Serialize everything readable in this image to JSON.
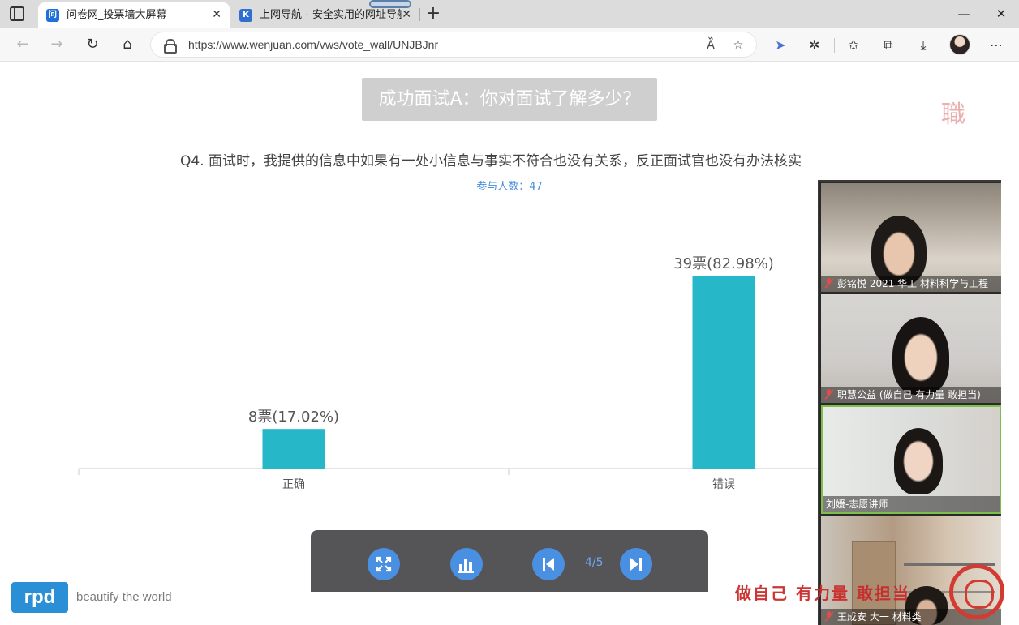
{
  "browser": {
    "tabs": [
      {
        "title": "问卷网_投票墙大屏幕",
        "active": true,
        "favicon": "wenjuan-icon"
      },
      {
        "title": "上网导航 - 安全实用的网址导航",
        "active": false,
        "favicon": "k-nav-icon"
      }
    ],
    "new_tab_label": "+",
    "url": "https://www.wenjuan.com/vws/vote_wall/UNJBJnr",
    "window_controls": {
      "minimize": "—",
      "maximize": "▢",
      "close": "✕"
    }
  },
  "page": {
    "title": "成功面试A：你对面试了解多少？",
    "question": "Q4. 面试时，我提供的信息中如果有一处小信息与事实不符合也没有关系，反正面试官也没有办法核实",
    "participants": "参与人数：47",
    "accent_color": "#4a90d9"
  },
  "chart_data": {
    "type": "bar",
    "categories": [
      "正确",
      "错误"
    ],
    "values": [
      8,
      39
    ],
    "data_labels": [
      "8票(17.02%)",
      "39票(82.98%)"
    ],
    "percentages": [
      17.02,
      82.98
    ],
    "ylim": [
      0,
      39
    ],
    "bar_color": "#26b8c8",
    "grid": false
  },
  "video_panel": {
    "participants": [
      {
        "name": "彭铭悦 2021 华工 材料科学与工程",
        "muted": true
      },
      {
        "name": "职慧公益 (做自己 有力量 敢担当)",
        "muted": true
      },
      {
        "name": "刘媛-志愿讲师",
        "muted": false,
        "speaking": true
      },
      {
        "name": "王成安 大一 材料类",
        "muted": true
      }
    ]
  },
  "controls": {
    "page_indicator": "4/5",
    "buttons": [
      "fullscreen-icon",
      "bar-chart-icon",
      "previous-icon",
      "next-icon"
    ],
    "button_color": "#4a90e2"
  },
  "footer": {
    "slogan": "beautify the world"
  }
}
